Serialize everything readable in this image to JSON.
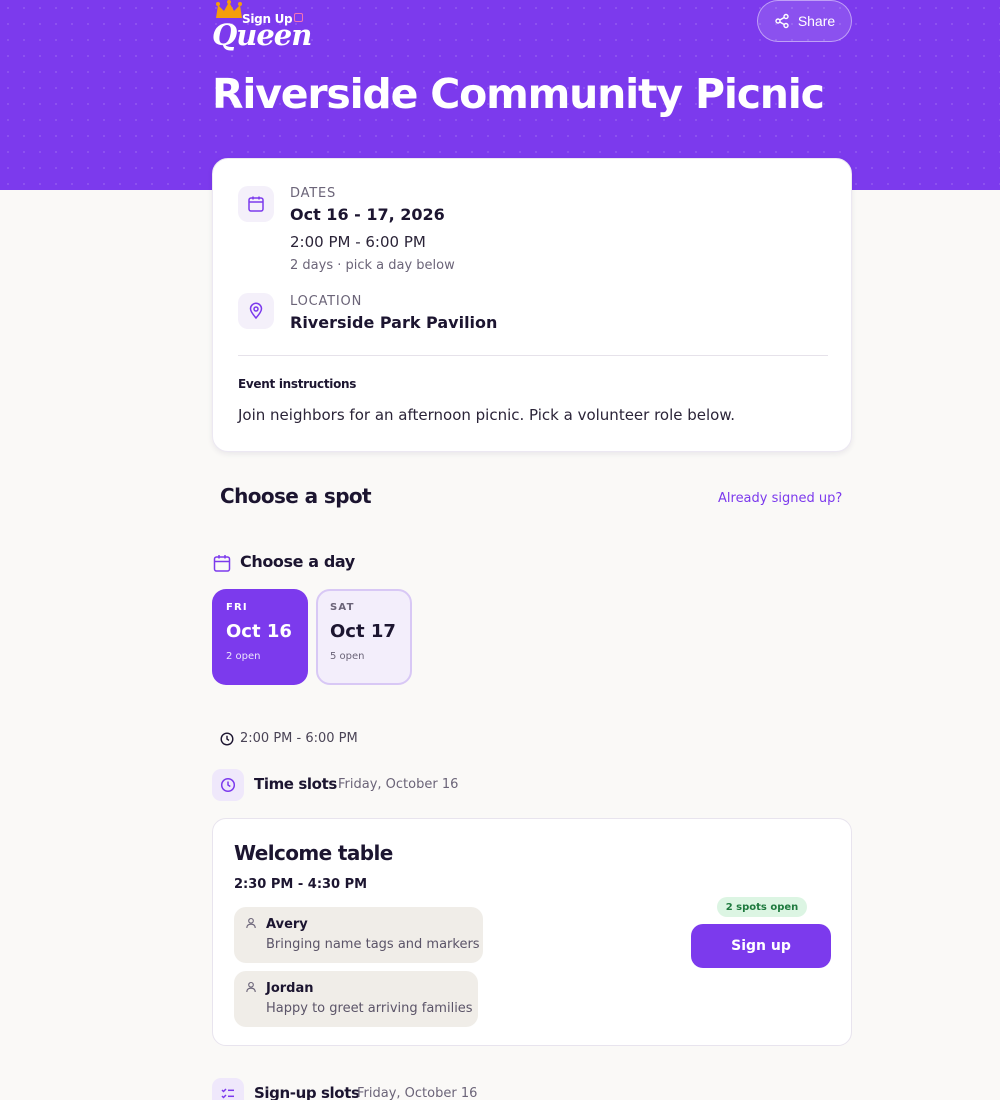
{
  "header": {
    "logo": {
      "line1": "Sign Up",
      "line2": "Queen"
    },
    "share_label": "Share",
    "title": "Riverside Community Picnic"
  },
  "info": {
    "dates_label": "DATES",
    "dates_value": "Oct 16 - 17, 2026",
    "time_range": "2:00 PM - 6:00 PM",
    "dates_note": "2 days · pick a day below",
    "location_label": "LOCATION",
    "location_value": "Riverside Park Pavilion",
    "instructions_heading": "Event instructions",
    "instructions_text": "Join neighbors for an afternoon picnic. Pick a volunteer role below."
  },
  "choose": {
    "heading": "Choose a spot",
    "already_link": "Already signed up?",
    "day_heading": "Choose a day",
    "days": [
      {
        "dow": "FRI",
        "date": "Oct 16",
        "open": "2 open",
        "selected": true
      },
      {
        "dow": "SAT",
        "date": "Oct 17",
        "open": "5 open",
        "selected": false
      }
    ]
  },
  "schedule": {
    "time_range": "2:00 PM - 6:00 PM",
    "time_slots_heading": "Time slots",
    "time_slots_date": "Friday, October 16",
    "slot": {
      "title": "Welcome table",
      "time": "2:30 PM - 4:30 PM",
      "spots_badge": "2 spots open",
      "signup_label": "Sign up",
      "people": [
        {
          "name": "Avery",
          "comment": "Bringing name tags and markers"
        },
        {
          "name": "Jordan",
          "comment": "Happy to greet arriving families"
        }
      ]
    },
    "signup_slots_heading": "Sign-up slots",
    "signup_slots_date": "Friday, October 16"
  },
  "colors": {
    "brand": "#7c3aed",
    "badge_bg": "#dcf5e3",
    "badge_text": "#1f7a3f"
  }
}
